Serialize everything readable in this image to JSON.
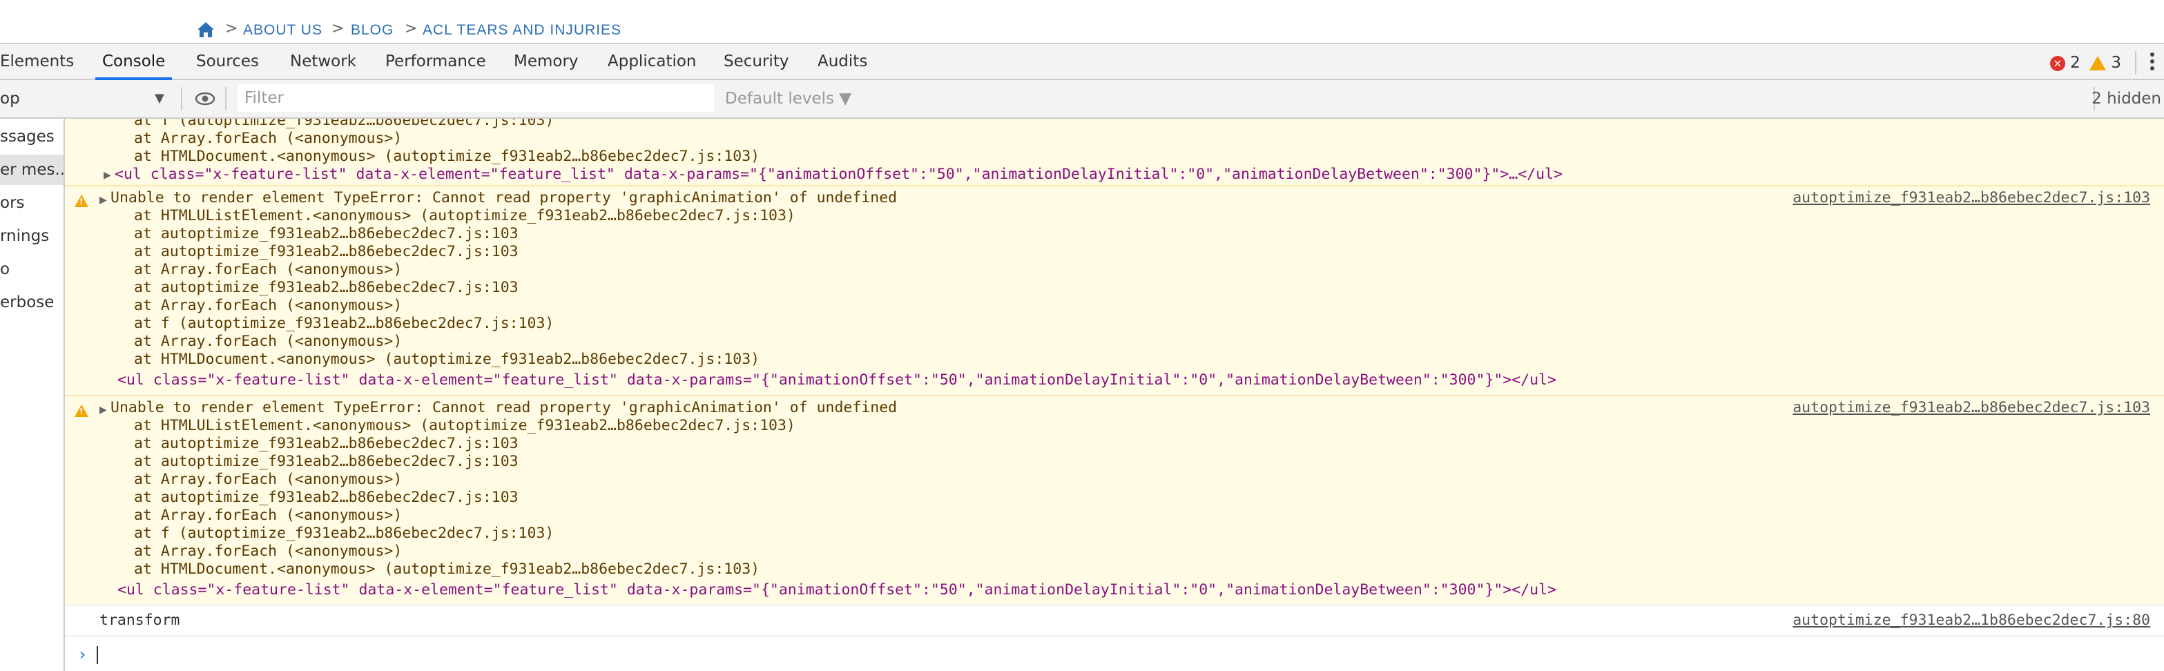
{
  "breadcrumb": {
    "items": [
      "ABOUT US",
      "BLOG",
      "ACL TEARS AND INJURIES"
    ],
    "separator": ">"
  },
  "tabs": [
    "Elements",
    "Console",
    "Sources",
    "Network",
    "Performance",
    "Memory",
    "Application",
    "Security",
    "Audits"
  ],
  "active_tab": "Console",
  "counts": {
    "errors": "2",
    "warnings": "3"
  },
  "toolbar": {
    "context": "op",
    "filter_placeholder": "Filter",
    "levels": "Default levels ▼",
    "hidden": "2 hidden"
  },
  "sidebar": [
    "ssages",
    "er mes...",
    "ors",
    "rnings",
    "o",
    "erbose"
  ],
  "console": {
    "top_lines": [
      "at f (autoptimize_f931eab2…b86ebec2dec7.js:103)",
      "at Array.forEach (<anonymous>)",
      "at HTMLDocument.<anonymous> (autoptimize_f931eab2…b86ebec2dec7.js:103)"
    ],
    "ul_line_collapsed": "<ul class=\"x-feature-list\" data-x-element=\"feature_list\" data-x-params=\"{\"animationOffset\":\"50\",\"animationDelayInitial\":\"0\",\"animationDelayBetween\":\"300\"}\">…</ul>",
    "warning_title": "Unable to render element TypeError: Cannot read property 'graphicAnimation' of undefined",
    "source": "autoptimize_f931eab2…b86ebec2dec7.js:103",
    "stack": [
      "at HTMLUListElement.<anonymous> (autoptimize_f931eab2…b86ebec2dec7.js:103)",
      "at autoptimize_f931eab2…b86ebec2dec7.js:103",
      "at autoptimize_f931eab2…b86ebec2dec7.js:103",
      "at Array.forEach (<anonymous>)",
      "at autoptimize_f931eab2…b86ebec2dec7.js:103",
      "at Array.forEach (<anonymous>)",
      "at f (autoptimize_f931eab2…b86ebec2dec7.js:103)",
      "at Array.forEach (<anonymous>)",
      "at HTMLDocument.<anonymous> (autoptimize_f931eab2…b86ebec2dec7.js:103)"
    ],
    "ul_line": "<ul class=\"x-feature-list\" data-x-element=\"feature_list\" data-x-params=\"{\"animationOffset\":\"50\",\"animationDelayInitial\":\"0\",\"animationDelayBetween\":\"300\"}\"></ul>",
    "transform_text": "transform",
    "transform_source": "autoptimize_f931eab2…1b86ebec2dec7.js:80"
  },
  "colors": {
    "accent": "#1a73e8",
    "warning_bg": "#fffbe5",
    "error": "#e0332c",
    "warning": "#f2a600",
    "link": "#2c70b4"
  }
}
